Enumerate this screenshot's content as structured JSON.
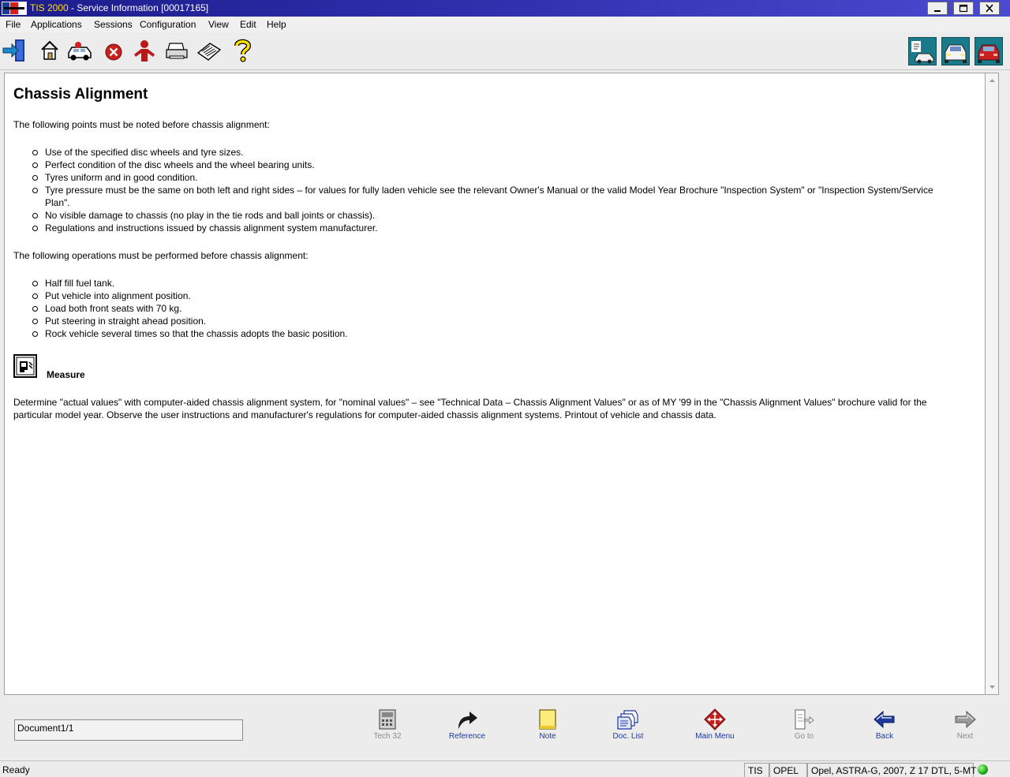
{
  "window": {
    "app_name": "TIS 2000",
    "title_rest": " - Service Information [00017165]"
  },
  "menu": [
    "File",
    "Applications",
    "Sessions",
    "Configuration",
    "View",
    "Edit",
    "Help"
  ],
  "toolbar_icons": [
    "exit-icon",
    "home-icon",
    "vehicle-select-icon",
    "stop-icon",
    "user-icon",
    "print-icon",
    "notebook-icon",
    "help-icon"
  ],
  "toolbar_right_icons": [
    "vehicle-info-icon",
    "vehicle-front-icon",
    "vehicle-rear-icon"
  ],
  "document": {
    "title": "Chassis Alignment",
    "intro1": "The following points must be noted before chassis alignment:",
    "points": [
      "Use of the specified disc wheels and tyre sizes.",
      "Perfect condition of the disc wheels and the wheel bearing units.",
      "Tyres uniform and in good condition.",
      "Tyre pressure must be the same on both left and right sides – for values for fully laden vehicle see the relevant Owner's Manual or the valid Model Year Brochure \"Inspection System\" or \"Inspection System/Service Plan\".",
      "No visible damage to chassis (no play in the tie rods and ball joints or chassis).",
      "Regulations and instructions issued by chassis alignment system manufacturer."
    ],
    "intro2": "The following operations must be performed before chassis alignment:",
    "operations": [
      "Half fill fuel tank.",
      "Put vehicle into alignment position.",
      "Load both front seats with 70 kg.",
      "Put steering in straight ahead position.",
      "Rock vehicle several times so that the chassis adopts the basic position."
    ],
    "measure_label": "Measure",
    "measure_text": "Determine \"actual values\" with computer-aided chassis alignment system, for \"nominal values\" – see \"Technical Data – Chassis Alignment Values\" or as of MY '99 in the \"Chassis Alignment Values\" brochure valid for the particular model year. Observe the user instructions and manufacturer's regulations for computer-aided chassis alignment systems. Printout of vehicle and chassis data."
  },
  "bottom": {
    "doc_counter": "Document1/1",
    "nav": [
      {
        "label": "Tech 32",
        "icon": "tech32-icon",
        "state": "disabled"
      },
      {
        "label": "Reference",
        "icon": "reference-arrow-icon",
        "state": "enabled"
      },
      {
        "label": "Note",
        "icon": "note-icon",
        "state": "enabled"
      },
      {
        "label": "Doc. List",
        "icon": "doc-list-icon",
        "state": "enabled"
      },
      {
        "label": "Main Menu",
        "icon": "main-menu-icon",
        "state": "enabled"
      },
      {
        "label": "Go to",
        "icon": "goto-icon",
        "state": "disabled"
      },
      {
        "label": "Back",
        "icon": "back-arrow-icon",
        "state": "enabled"
      },
      {
        "label": "Next",
        "icon": "next-arrow-icon",
        "state": "disabled"
      }
    ]
  },
  "status": {
    "text": "Ready",
    "system": "TIS",
    "brand": "OPEL",
    "vehicle": "Opel, ASTRA-G, 2007, Z 17 DTL, 5-MT"
  },
  "colors": {
    "title_bar": "#1c1c8c",
    "link_blue": "#1e3a9c",
    "stop_red": "#c8201c",
    "status_led": "#1aa81a"
  }
}
